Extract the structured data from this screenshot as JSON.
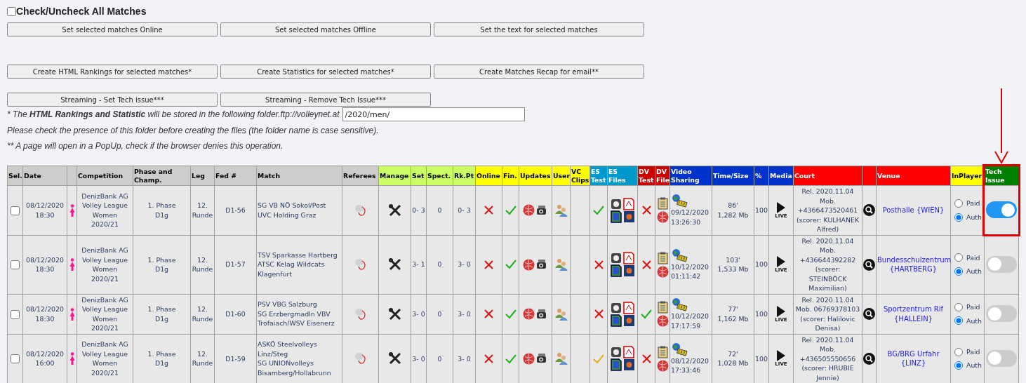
{
  "check_all": {
    "label": "Check/Uncheck All Matches",
    "checked": false
  },
  "button_rows": [
    [
      "Set selected matches Online",
      "Set selected matches Offline",
      "Set the text for selected matches"
    ],
    [
      "Create HTML Rankings for selected matches*",
      "Create Statistics for selected matches*",
      "Create Matches Recap for email**"
    ],
    [
      "Streaming - Set Tech issue***",
      "Streaming - Remove Tech Issue***"
    ]
  ],
  "folder_note": "* The **HTML Rankings and Statistic** will be stored in the following folder.ftp://volleynet.at",
  "folder_field": {
    "value": "/2020/men/"
  },
  "notes": [
    "Please check the presence of this folder before creating the files (the folder name is case sensitive).",
    "** A page will open in a PopUp, check if the browser denies this operation."
  ],
  "columns": [
    {
      "label": "Sel.",
      "kind": "plain"
    },
    {
      "label": "Date",
      "kind": "plain"
    },
    {
      "kind": "plain"
    },
    {
      "label": "Competition",
      "kind": "plain"
    },
    {
      "label": "Phase and Champ.",
      "kind": "plain"
    },
    {
      "label": "Leg",
      "kind": "plain"
    },
    {
      "label": "Fed #",
      "kind": "plain"
    },
    {
      "label": "Match",
      "kind": "plain"
    },
    {
      "label": "Referees",
      "kind": "plain"
    },
    {
      "label": "Manage",
      "kind": "manage"
    },
    {
      "label": "Set",
      "kind": "manage"
    },
    {
      "label": "Spect.",
      "kind": "manage"
    },
    {
      "label": "Rk.Pt",
      "kind": "manage"
    },
    {
      "label": "Online",
      "kind": "status"
    },
    {
      "label": "Fin.",
      "kind": "status"
    },
    {
      "label": "Updates",
      "kind": "status"
    },
    {
      "label": "User",
      "kind": "status"
    },
    {
      "label": "VC Clips",
      "kind": "status"
    },
    {
      "label": "ES Test",
      "kind": "es"
    },
    {
      "label": "ES Files",
      "kind": "es"
    },
    {
      "label": "DV Test",
      "kind": "dv"
    },
    {
      "label": "DV File",
      "kind": "dv"
    },
    {
      "label": "Video Sharing",
      "kind": "video"
    },
    {
      "label": "Time/Size",
      "kind": "video"
    },
    {
      "label": "%",
      "kind": "video"
    },
    {
      "label": "Media",
      "kind": "video"
    },
    {
      "label": "Court",
      "kind": "venue"
    },
    {
      "kind": "venue"
    },
    {
      "label": "Venue",
      "kind": "venue"
    },
    {
      "label": "InPlayer",
      "kind": "status"
    },
    {
      "label": "Tech Issue",
      "kind": "tech"
    }
  ],
  "rows": [
    {
      "selected": false,
      "date": "08/12/2020",
      "time": "18:30",
      "competition": "DenizBank AG Volley League Women 2020/21",
      "phase": "1. Phase D1g",
      "leg": "12. Runde",
      "fed": "D1-56",
      "match_lines": [
        "SG VB NÖ Sokol/Post",
        "UVC Holding Graz"
      ],
      "set": "0- 3",
      "spect": "0",
      "rkpt": "0- 3",
      "online": {
        "kind": "cross"
      },
      "fin": {
        "kind": "check"
      },
      "es_test": {
        "kind": "check"
      },
      "dv_test": {
        "kind": "cross"
      },
      "share_date": "09/12/2020",
      "share_time": "13:26:30",
      "duration": "86'",
      "size": "1,282 Mb",
      "percent": "100",
      "media_label": "LIVE",
      "court_lines": [
        "Rel. 2020.11.04",
        "Mob.",
        "+4366473520461",
        "(scorer: KULHANEK",
        "Alfred)"
      ],
      "venue": "Posthalle {WIEN}",
      "inplayer": [
        {
          "label": "Paid",
          "selected": false
        },
        {
          "label": "Auth",
          "selected": true
        }
      ],
      "tech_issue": true
    },
    {
      "selected": false,
      "date": "08/12/2020",
      "time": "18:30",
      "competition": "DenizBank AG Volley League Women 2020/21",
      "phase": "1. Phase D1g",
      "leg": "12. Runde",
      "fed": "D1-57",
      "match_lines": [
        "TSV Sparkasse Hartberg",
        "ATSC Kelag Wildcats",
        "Klagenfurt"
      ],
      "set": "3- 1",
      "spect": "0",
      "rkpt": "3- 0",
      "online": {
        "kind": "cross"
      },
      "fin": {
        "kind": "check"
      },
      "es_test": {
        "kind": "cross"
      },
      "dv_test": {
        "kind": "cross"
      },
      "share_date": "10/12/2020",
      "share_time": "01:11:42",
      "duration": "103'",
      "size": "1,533 Mb",
      "percent": "100",
      "media_label": "LIVE",
      "court_lines": [
        "Rel. 2020.11.04",
        "Mob.",
        "+436644392282",
        "(scorer:",
        "STEINBÖCK",
        "Maximilian)"
      ],
      "venue": "Bundesschulzentrum {HARTBERG}",
      "inplayer": [
        {
          "label": "Paid",
          "selected": false
        },
        {
          "label": "Auth",
          "selected": true
        }
      ],
      "tech_issue": false
    },
    {
      "selected": false,
      "date": "08/12/2020",
      "time": "18:30",
      "competition": "DenizBank AG Volley League Women 2020/21",
      "phase": "1. Phase D1g",
      "leg": "12. Runde",
      "fed": "D1-60",
      "match_lines": [
        "PSV VBG Salzburg",
        "SG Erzbergmadln VBV",
        "Trofaiach/WSV Eisenerz"
      ],
      "set": "3- 0",
      "spect": "0",
      "rkpt": "3- 0",
      "online": {
        "kind": "cross"
      },
      "fin": {
        "kind": "check"
      },
      "es_test": {
        "kind": "cross"
      },
      "dv_test": {
        "kind": "check"
      },
      "share_date": "10/12/2020",
      "share_time": "17:17:59",
      "duration": "77'",
      "size": "1,162 Mb",
      "percent": "100",
      "media_label": "LIVE",
      "court_lines": [
        "Rel. 2020.11.04",
        "Mob. 06769378103",
        "(scorer: Halilovic",
        "Denisa)"
      ],
      "venue": "Sportzentrum Rif {HALLEIN}",
      "inplayer": [
        {
          "label": "Paid",
          "selected": false
        },
        {
          "label": "Auth",
          "selected": true
        }
      ],
      "tech_issue": false
    },
    {
      "selected": false,
      "date": "08/12/2020",
      "time": "16:00",
      "competition": "DenizBank AG Volley League Women 2020/21",
      "phase": "1. Phase D1g",
      "leg": "12. Runde",
      "fed": "D1-59",
      "match_lines": [
        "ASKÖ Steelvolleys",
        "Linz/Steg",
        "SG UNIONvolleys",
        "Bisamberg/Hollabrunn"
      ],
      "set": "3- 0",
      "spect": "0",
      "rkpt": "3- 0",
      "online": {
        "kind": "cross"
      },
      "fin": {
        "kind": "check"
      },
      "es_test": {
        "kind": "warning"
      },
      "dv_test": {
        "kind": "cross"
      },
      "share_date": "08/12/2020",
      "share_time": "17:33:46",
      "duration": "72'",
      "size": "1,028 Mb",
      "percent": "100",
      "media_label": "LIVE",
      "court_lines": [
        "Rel. 2020.11.04",
        "Mob.",
        "+436505550656",
        "(scorer: HRUBIE",
        "Jennie)"
      ],
      "venue": "BG/BRG Urfahr {LINZ}",
      "inplayer": [
        {
          "label": "Paid",
          "selected": false
        },
        {
          "label": "Auth",
          "selected": true
        }
      ],
      "tech_issue": false
    }
  ]
}
